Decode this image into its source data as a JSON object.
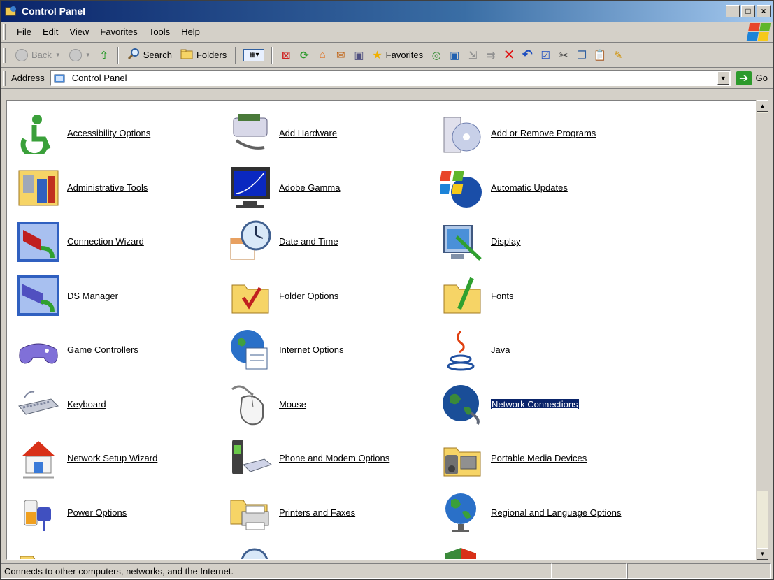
{
  "window": {
    "title": "Control Panel"
  },
  "menu": [
    "File",
    "Edit",
    "View",
    "Favorites",
    "Tools",
    "Help"
  ],
  "toolbar": {
    "back": "Back",
    "search": "Search",
    "folders": "Folders",
    "favorites": "Favorites"
  },
  "address": {
    "label": "Address",
    "value": "Control Panel",
    "go": "Go"
  },
  "items": [
    [
      "Accessibility Options",
      "Add Hardware",
      "Add or Remove Programs"
    ],
    [
      "Administrative Tools",
      "Adobe Gamma",
      "Automatic Updates"
    ],
    [
      "Connection Wizard",
      "Date and Time",
      "Display"
    ],
    [
      "DS Manager",
      "Folder Options",
      "Fonts"
    ],
    [
      "Game Controllers",
      "Internet Options",
      "Java"
    ],
    [
      "Keyboard",
      "Mouse",
      "Network Connections"
    ],
    [
      "Network Setup Wizard",
      "Phone and Modem Options",
      "Portable Media Devices"
    ],
    [
      "Power Options",
      "Printers and Faxes",
      "Regional and Language Options"
    ]
  ],
  "status": {
    "text": "Connects to other computers, networks, and the Internet."
  }
}
